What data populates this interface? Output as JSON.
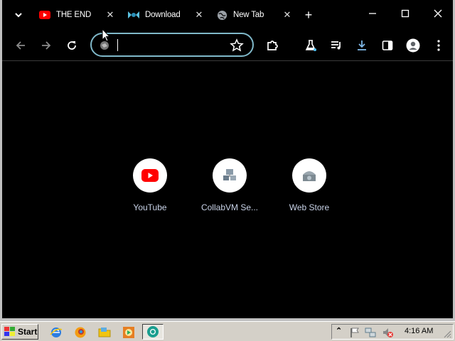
{
  "browser": {
    "tabs": [
      {
        "label": "THE END \\",
        "favicon": "youtube-icon",
        "active": false
      },
      {
        "label": "Download",
        "favicon": "collabvm-icon",
        "active": false
      },
      {
        "label": "New Tab",
        "favicon": "globe-icon",
        "active": true
      }
    ],
    "close_symbol": "✕",
    "new_tab_symbol": "+",
    "omnibox": {
      "value": "",
      "placeholder": ""
    }
  },
  "shortcuts": [
    {
      "title": "YouTube",
      "icon": "youtube-icon"
    },
    {
      "title": "CollabVM Se...",
      "icon": "collabvm-icon"
    },
    {
      "title": "Web Store",
      "icon": "web-store-icon"
    }
  ],
  "taskbar": {
    "start_label": "Start",
    "clock": "4:16 AM",
    "tray_expand": "⌃"
  },
  "colors": {
    "accent_focus_ring": "#7fb8c9",
    "youtube_red": "#ff0000",
    "shortcut_title": "#c9d3e8",
    "taskbar": "#d4d0c8"
  }
}
